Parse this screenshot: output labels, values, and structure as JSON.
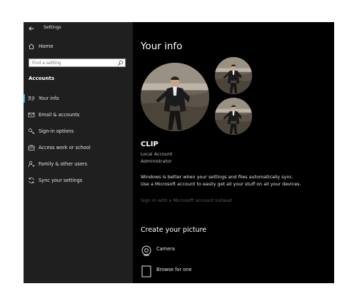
{
  "window": {
    "title": "Settings"
  },
  "sidebar": {
    "home_label": "Home",
    "search_placeholder": "Find a setting",
    "section_title": "Accounts",
    "items": [
      {
        "label": "Your info",
        "icon": "person-card-icon",
        "active": true
      },
      {
        "label": "Email & accounts",
        "icon": "mail-icon"
      },
      {
        "label": "Sign-in options",
        "icon": "key-icon"
      },
      {
        "label": "Access work or school",
        "icon": "briefcase-icon"
      },
      {
        "label": "Family & other users",
        "icon": "person-add-icon"
      },
      {
        "label": "Sync your settings",
        "icon": "sync-icon"
      }
    ]
  },
  "main": {
    "title": "Your info",
    "user_name": "CLIP",
    "account_type": "Local Account",
    "account_role": "Administrator",
    "sync_message": "Windows is better when your settings and files automatically sync. Use a Microsoft account to easily get all your stuff on all your devices.",
    "ms_link": "Sign in with a Microsoft account instead",
    "create_title": "Create your picture",
    "options": [
      {
        "label": "Camera",
        "icon": "camera-icon"
      },
      {
        "label": "Browse for one",
        "icon": "browse-icon"
      }
    ]
  },
  "colors": {
    "accent": "#3a96dd",
    "sidebar_bg": "#1f1f1f",
    "main_bg": "#000000"
  }
}
